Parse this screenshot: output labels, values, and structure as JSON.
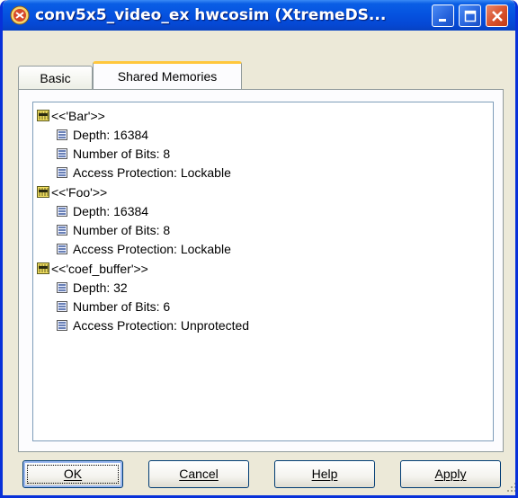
{
  "window": {
    "title": "conv5x5_video_ex hwcosim (XtremeDS...",
    "accent": "#0553e0",
    "close_color": "#d8512c"
  },
  "tabs": [
    {
      "label": "Basic",
      "active": false
    },
    {
      "label": "Shared Memories",
      "active": true
    }
  ],
  "tree": {
    "groups": [
      {
        "label": "<<'Bar'>>",
        "items": [
          "Depth: 16384",
          "Number of Bits: 8",
          "Access Protection: Lockable"
        ]
      },
      {
        "label": "<<'Foo'>>",
        "items": [
          "Depth: 16384",
          "Number of Bits: 8",
          "Access Protection: Lockable"
        ]
      },
      {
        "label": "<<'coef_buffer'>>",
        "items": [
          "Depth: 32",
          "Number of Bits: 6",
          "Access Protection: Unprotected"
        ]
      }
    ]
  },
  "buttons": {
    "ok": "OK",
    "cancel": "Cancel",
    "help": "Help",
    "apply": "Apply"
  },
  "icons": {
    "app": "xilinx-app-icon",
    "group": "memory-block-icon",
    "property": "property-leaf-icon"
  }
}
